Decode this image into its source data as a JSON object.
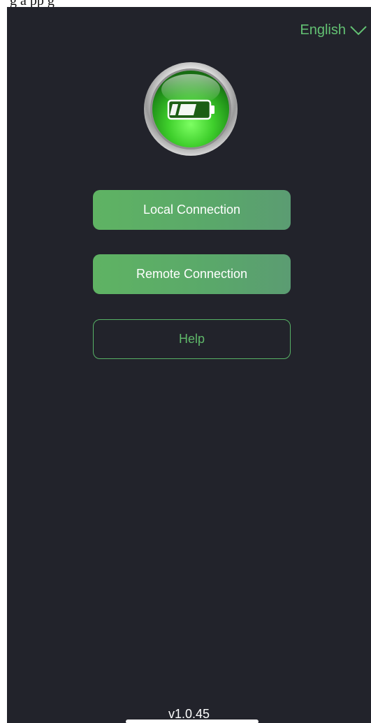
{
  "caption": {
    "text": "g    a   pp g"
  },
  "header": {
    "language": "English",
    "language_icon": "chevron-down-icon"
  },
  "logo": {
    "icon": "battery-icon"
  },
  "buttons": {
    "local": "Local Connection",
    "remote": "Remote Connection",
    "help": "Help"
  },
  "footer": {
    "version": "v1.0.45"
  },
  "colors": {
    "background": "#22232b",
    "accent": "#5fb363",
    "text": "#ffffff"
  }
}
